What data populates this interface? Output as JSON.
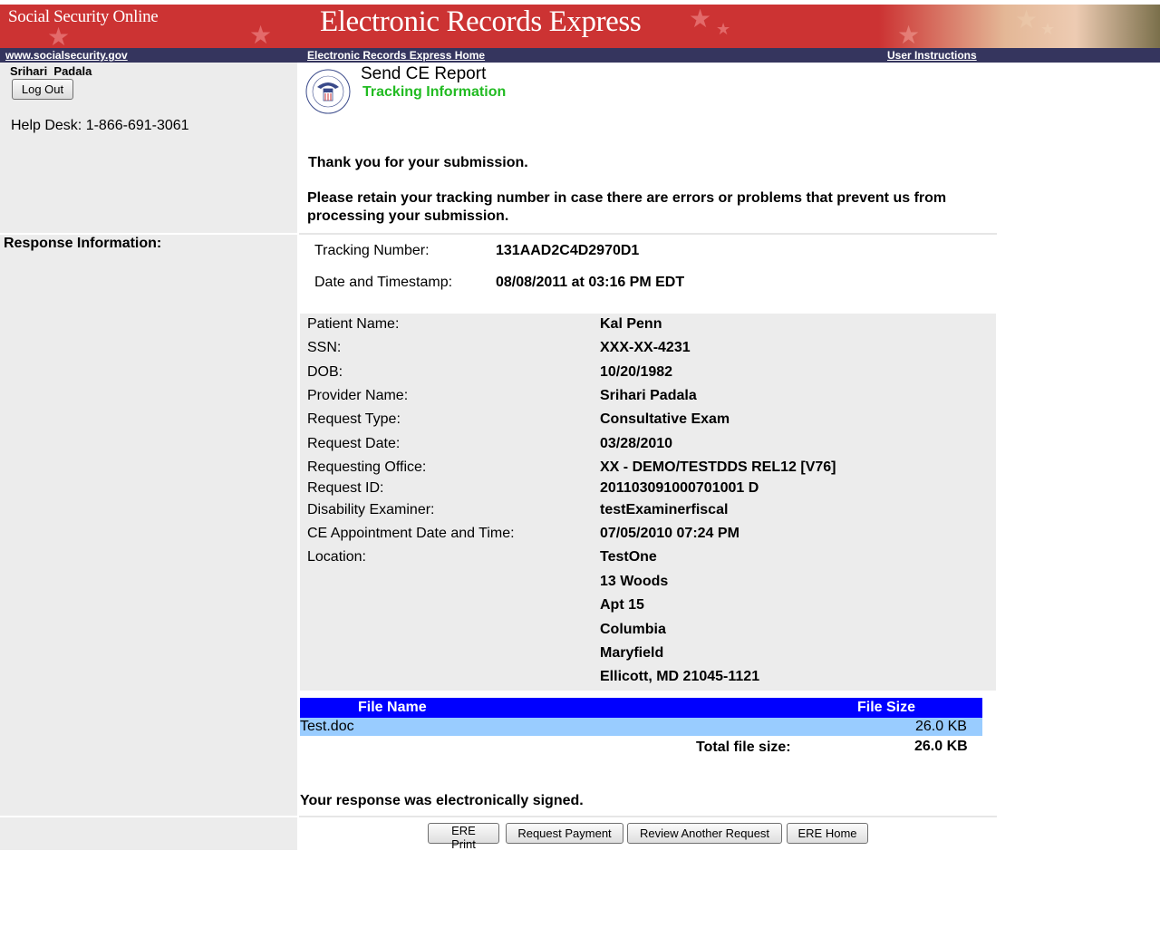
{
  "banner": {
    "brand": "Social Security Online",
    "title": "Electronic Records Express"
  },
  "nav": {
    "site_link": "www.socialsecurity.gov",
    "home_link": "Electronic Records Express Home",
    "instructions_link": "User Instructions"
  },
  "sidebar": {
    "user_name": "Srihari  Padala",
    "logout_label": "Log Out",
    "helpdesk": "Help Desk: 1-866-691-3061",
    "response_heading": "Response Information:"
  },
  "header": {
    "title": "Send CE Report",
    "subtitle": "Tracking Information"
  },
  "message": {
    "thanks": "Thank you for your submission.",
    "retain": "Please retain your tracking number in case there are errors or problems that prevent us from processing your submission."
  },
  "tracking": {
    "number_label": "Tracking Number:",
    "number_value": "131AAD2C4D2970D1",
    "timestamp_label": "Date and Timestamp:",
    "timestamp_value": "08/08/2011 at 03:16 PM EDT"
  },
  "details": [
    {
      "label": "Patient Name:",
      "value": "Kal Penn"
    },
    {
      "label": "SSN:",
      "value": "XXX-XX-4231"
    },
    {
      "label": "DOB:",
      "value": "10/20/1982"
    },
    {
      "label": "Provider Name:",
      "value": "Srihari Padala"
    },
    {
      "label": "Request Type:",
      "value": "Consultative Exam"
    },
    {
      "label": "Request Date:",
      "value": "03/28/2010"
    },
    {
      "label": "Requesting Office:",
      "value": "XX - DEMO/TESTDDS REL12 [V76]"
    },
    {
      "label": "Request ID:",
      "value": "201103091000701001 D"
    },
    {
      "label": "Disability Examiner:",
      "value": "testExaminerfiscal"
    },
    {
      "label": "CE Appointment Date and Time:",
      "value": "07/05/2010 07:24 PM"
    },
    {
      "label": "Location:",
      "value": "TestOne"
    }
  ],
  "location_extra": [
    "13 Woods",
    "Apt 15",
    "Columbia",
    "Maryfield",
    "Ellicott, MD 21045-1121"
  ],
  "files": {
    "header_name": "File Name",
    "header_size": "File Size",
    "rows": [
      {
        "name": "Test.doc",
        "size": "26.0 KB"
      }
    ],
    "total_label": "Total file size:",
    "total_value": "26.0 KB"
  },
  "signed": "Your response was electronically signed.",
  "buttons": {
    "print": "ERE Print",
    "payment": "Request Payment",
    "review": "Review Another Request",
    "home": "ERE Home"
  },
  "colors": {
    "banner": "#cc3333",
    "navbar": "#35355e",
    "subtitle": "#22bb22",
    "table_header": "#0000ff",
    "table_row": "#99ccff",
    "sidebar": "#ececec"
  }
}
